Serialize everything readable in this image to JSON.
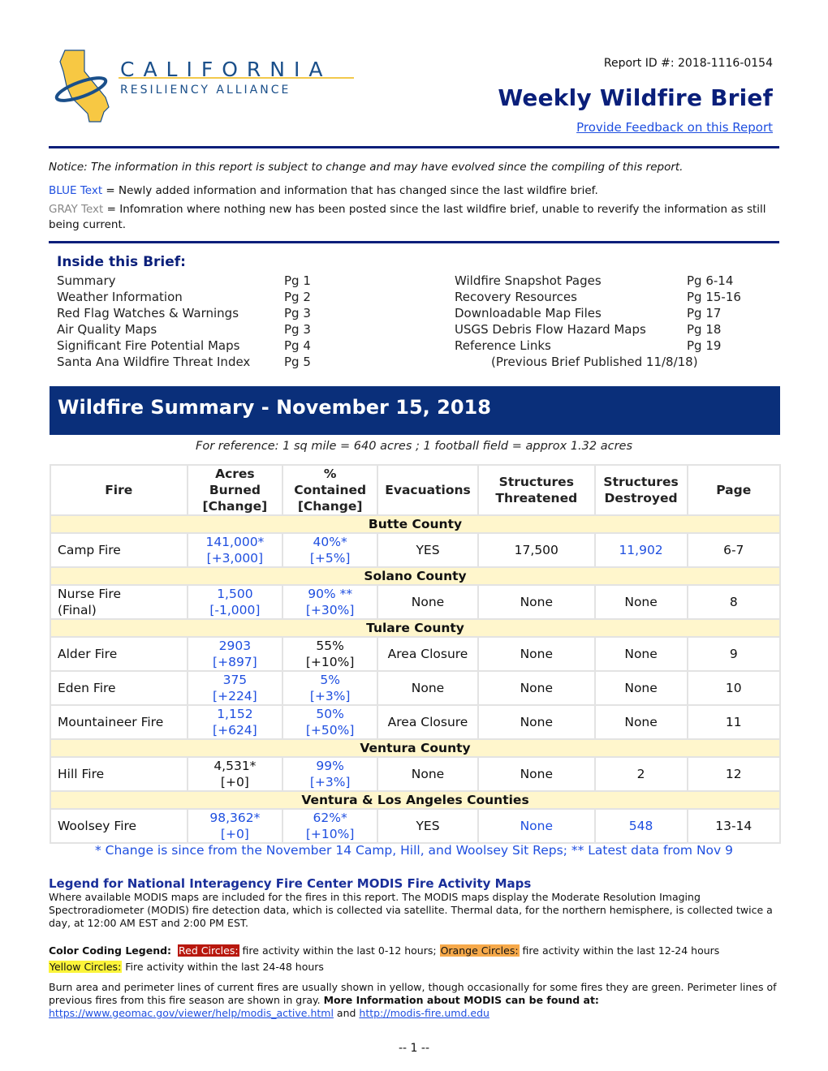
{
  "header": {
    "logo": {
      "line1": "CALIFORNIA",
      "line2": "RESILIENCY ALLIANCE",
      "brand_blue": "#1a4f8a",
      "brand_gold": "#f7c843"
    },
    "report_id": "Report ID #: 2018-1116-0154",
    "title": "Weekly Wildfire Brief",
    "feedback_link": "Provide Feedback on this Report"
  },
  "notice": {
    "text": "Notice: The information in this report is subject to change and may have evolved since the compiling of this report.",
    "blue_key": "BLUE Text",
    "blue_desc": " = Newly added information and information that has changed since the last wildfire brief.",
    "gray_key": "GRAY Text",
    "gray_desc": " = Infomration where nothing new has been posted since the last wildfire brief, unable to reverify the information as still being current."
  },
  "toc": {
    "title": "Inside this Brief:",
    "left": [
      {
        "label": "Summary",
        "page": "Pg 1"
      },
      {
        "label": "Weather Information",
        "page": "Pg 2"
      },
      {
        "label": "Red Flag Watches & Warnings",
        "page": "Pg 3"
      },
      {
        "label": "Air Quality Maps",
        "page": "Pg 3"
      },
      {
        "label": "Significant Fire Potential Maps",
        "page": "Pg 4"
      },
      {
        "label": "Santa Ana Wildfire Threat Index",
        "page": "Pg 5"
      }
    ],
    "right": [
      {
        "label": "Wildfire Snapshot Pages",
        "page": "Pg 6-14"
      },
      {
        "label": "Recovery Resources",
        "page": "Pg 15-16"
      },
      {
        "label": "Downloadable Map Files",
        "page": "Pg 17"
      },
      {
        "label": "USGS Debris Flow Hazard Maps",
        "page": "Pg 18"
      },
      {
        "label": "Reference Links",
        "page": "Pg 19"
      }
    ],
    "previous_brief": "(Previous Brief Published 11/8/18)"
  },
  "summary": {
    "banner": "Wildfire Summary - November 15, 2018",
    "reference": "For reference: 1 sq mile = 640 acres ;  1 football field = approx 1.32 acres",
    "columns": {
      "fire": "Fire",
      "acres": [
        "Acres",
        "Burned",
        "[Change]"
      ],
      "contained": [
        "%",
        "Contained",
        "[Change]"
      ],
      "evacuations": "Evacuations",
      "threatened": [
        "Structures",
        "Threatened"
      ],
      "destroyed": [
        "Structures",
        "Destroyed"
      ],
      "page": "Page"
    },
    "groups": [
      {
        "county": "Butte County",
        "fires": [
          {
            "name": [
              "Camp Fire"
            ],
            "acres": "141,000*",
            "acres_change": "[+3,000]",
            "acres_color": "blue",
            "contained": "40%*",
            "contained_change": "[+5%]",
            "contained_color": "blue",
            "evacuations": "YES",
            "threatened": "17,500",
            "threatened_color": "black",
            "destroyed": "11,902",
            "destroyed_color": "blue",
            "page": "6-7"
          }
        ]
      },
      {
        "county": "Solano County",
        "fires": [
          {
            "name": [
              "Nurse Fire",
              "(Final)"
            ],
            "acres": "1,500",
            "acres_change": "[-1,000]",
            "acres_color": "blue",
            "contained": "90% **",
            "contained_change": "[+30%]",
            "contained_color": "blue",
            "evacuations": "None",
            "threatened": "None",
            "threatened_color": "black",
            "destroyed": "None",
            "destroyed_color": "black",
            "page": "8"
          }
        ]
      },
      {
        "county": "Tulare County",
        "fires": [
          {
            "name": [
              "Alder Fire"
            ],
            "acres": "2903",
            "acres_change": "[+897]",
            "acres_color": "blue",
            "contained": "55%",
            "contained_change": "[+10%]",
            "contained_color": "black",
            "evacuations": "Area Closure",
            "threatened": "None",
            "threatened_color": "black",
            "destroyed": "None",
            "destroyed_color": "black",
            "page": "9"
          },
          {
            "name": [
              "Eden Fire"
            ],
            "acres": "375",
            "acres_change": "[+224]",
            "acres_color": "blue",
            "contained": "5%",
            "contained_change": "[+3%]",
            "contained_color": "blue",
            "evacuations": "None",
            "threatened": "None",
            "threatened_color": "black",
            "destroyed": "None",
            "destroyed_color": "black",
            "page": "10"
          },
          {
            "name": [
              "Mountaineer Fire"
            ],
            "acres": "1,152",
            "acres_change": "[+624]",
            "acres_color": "blue",
            "contained": "50%",
            "contained_change": "[+50%]",
            "contained_color": "blue",
            "evacuations": "Area Closure",
            "threatened": "None",
            "threatened_color": "black",
            "destroyed": "None",
            "destroyed_color": "black",
            "page": "11"
          }
        ]
      },
      {
        "county": "Ventura County",
        "fires": [
          {
            "name": [
              "Hill Fire"
            ],
            "acres": "4,531*",
            "acres_change": "[+0]",
            "acres_color": "black",
            "contained": "99%",
            "contained_change": "[+3%]",
            "contained_color": "blue",
            "evacuations": "None",
            "threatened": "None",
            "threatened_color": "black",
            "destroyed": "2",
            "destroyed_color": "black",
            "page": "12"
          }
        ]
      },
      {
        "county": "Ventura & Los Angeles Counties",
        "fires": [
          {
            "name": [
              "Woolsey Fire"
            ],
            "acres": "98,362*",
            "acres_change": "[+0]",
            "acres_color": "blue",
            "contained": "62%*",
            "contained_change": "[+10%]",
            "contained_color": "blue",
            "evacuations": "YES",
            "threatened": "None",
            "threatened_color": "blue",
            "destroyed": "548",
            "destroyed_color": "blue",
            "page": "13-14"
          }
        ]
      }
    ],
    "footnote": "* Change is since from the November 14 Camp, Hill, and Woolsey Sit Reps; ** Latest data from Nov 9"
  },
  "modis": {
    "title": "Legend for National Interagency Fire Center MODIS Fire Activity Maps",
    "body": "Where available MODIS maps are included for the fires in this report. The MODIS maps display the Moderate Resolution Imaging Spectroradiometer (MODIS) fire detection data, which is collected via satellite. Thermal data, for the northern hemisphere, is collected twice a day, at 12:00 AM EST and 2:00 PM EST.",
    "color_legend_label": "Color Coding Legend:",
    "red_label": "Red Circles:",
    "red_desc": " fire activity within the last 0-12 hours;  ",
    "orange_label": "Orange Circles:",
    "orange_desc": " fire activity within the last 12-24 hours",
    "yellow_label": "Yellow Circles:",
    "yellow_desc": " Fire activity within the last 24-48 hours",
    "burn_text": "Burn area and perimeter lines of current fires are usually shown in yellow, though occasionally for some fires they are green. Perimeter lines of previous fires from this fire season are shown in gray. ",
    "more_info": "More Information about MODIS can be found at: ",
    "link1": "https://www.geomac.gov/viewer/help/modis_active.html",
    "and": " and ",
    "link2": "http://modis-fire.umd.edu"
  },
  "colors": {
    "blue_text": "#1f4fe0",
    "navy": "#0a1f7a",
    "county_bg": "#fff6cc"
  },
  "footer": {
    "page": "-- 1 --"
  }
}
